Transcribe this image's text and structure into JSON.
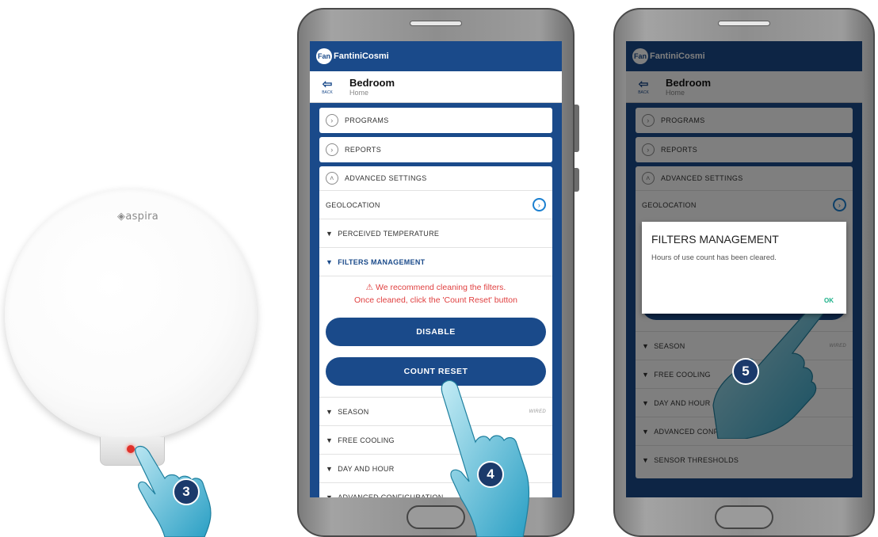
{
  "device": {
    "brand": "aspira"
  },
  "steps": [
    "3",
    "4",
    "5"
  ],
  "app": {
    "brand": "FantiniCosmi",
    "brand_mark": "Fan",
    "back_label": "BACK",
    "room_name": "Bedroom",
    "room_sub": "Home",
    "menu": {
      "programs": "PROGRAMS",
      "reports": "REPORTS",
      "advanced": "ADVANCED SETTINGS"
    },
    "rows": {
      "geolocation": "GEOLOCATION",
      "perceived": "PERCEIVED TEMPERATURE",
      "filters": "FILTERS MANAGEMENT",
      "season": "SEASON",
      "free_cooling": "FREE COOLING",
      "day_hour": "DAY AND HOUR",
      "adv_config": "ADVANCED CONFIGURATION",
      "sensor_thresholds": "SENSOR THRESHOLDS"
    },
    "season_value": "WIRED",
    "warning_line1": "We recommend cleaning the filters.",
    "warning_line2": "Once cleaned, click the 'Count Reset' button",
    "disable_label": "DISABLE",
    "count_reset_label": "COUNT RESET"
  },
  "dialog": {
    "title": "FILTERS MANAGEMENT",
    "message": "Hours of use count has been cleared.",
    "ok": "OK"
  },
  "colors": {
    "primary": "#1a4a8a",
    "warning": "#e04040",
    "ok": "#1ab088",
    "badge": "#1b3a6b"
  }
}
